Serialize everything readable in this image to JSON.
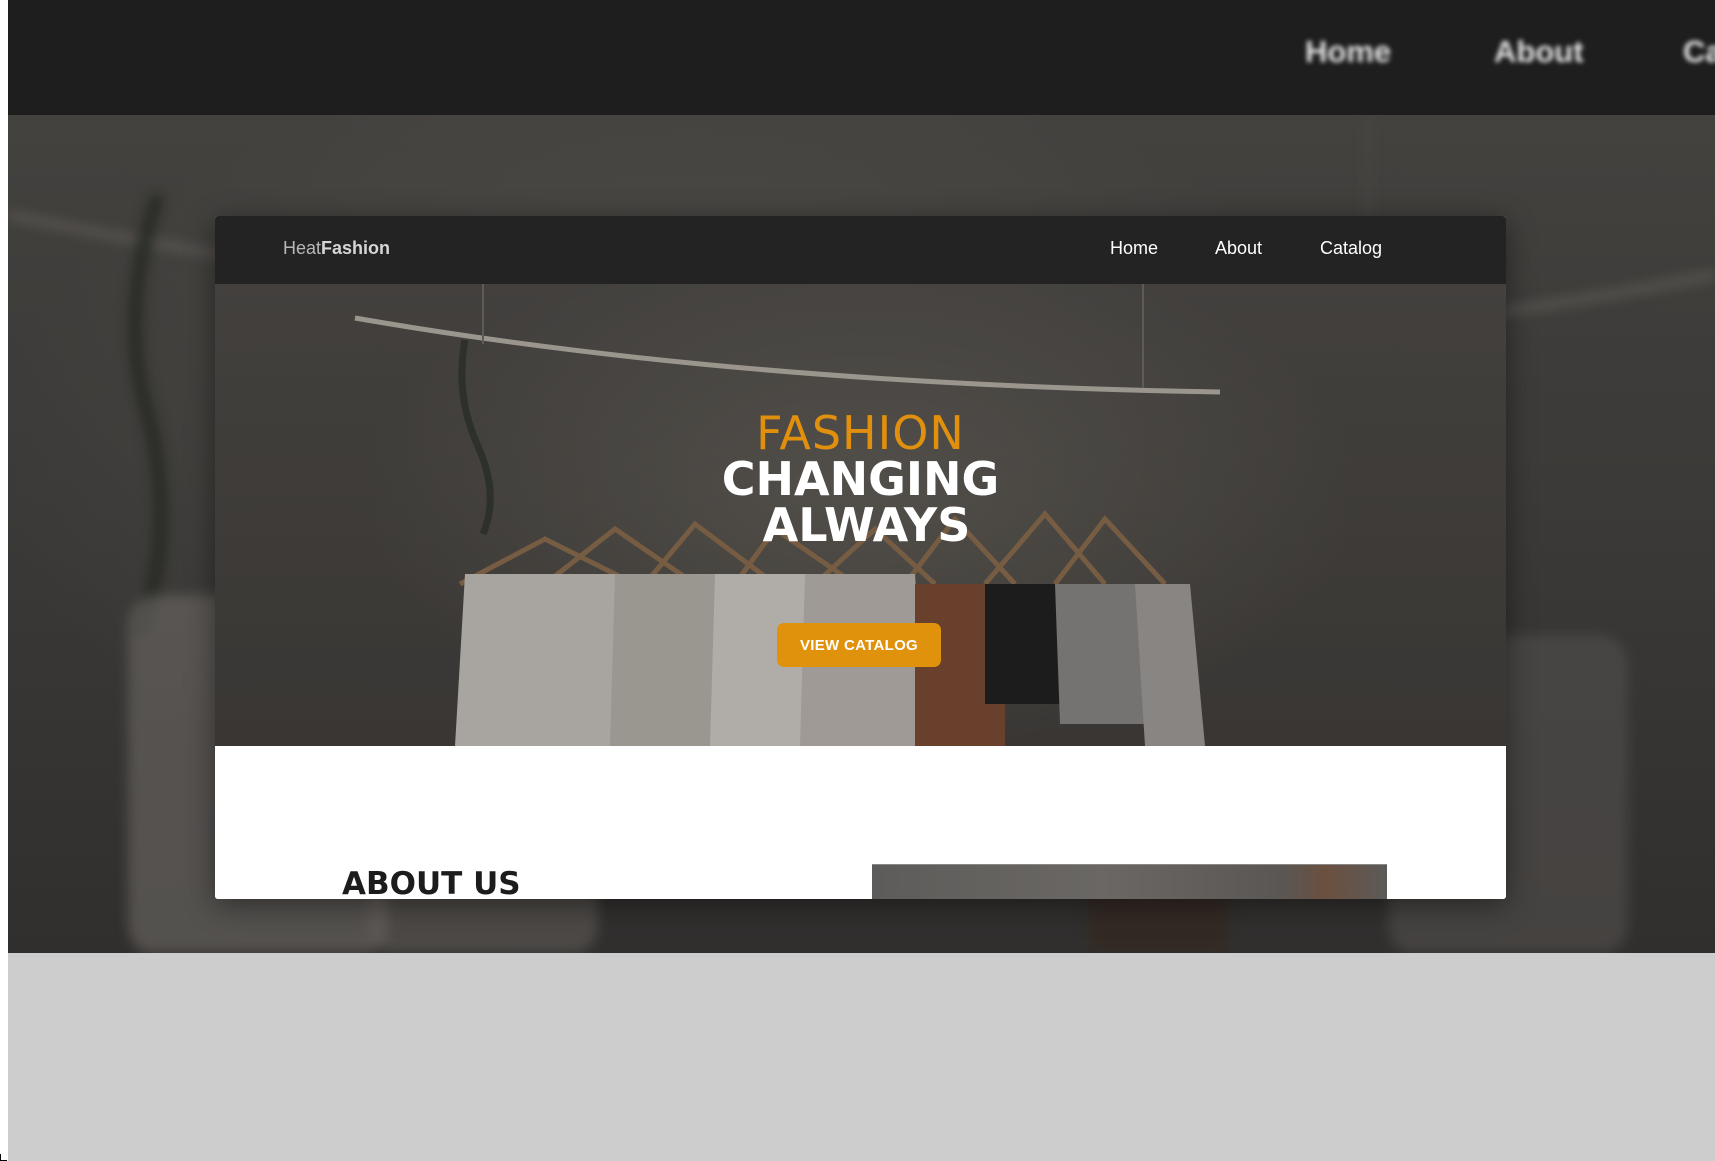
{
  "background": {
    "nav_links": [
      "Home",
      "About",
      "Ca"
    ]
  },
  "window": {
    "logo_light": "Heat",
    "logo_bold": "Fashion",
    "nav": {
      "home": "Home",
      "about": "About",
      "catalog": "Catalog"
    },
    "hero": {
      "line1": "FASHION",
      "line2": "CHANGING",
      "line3": "ALWAYS",
      "button": "VIEW CATALOG"
    },
    "about": {
      "heading": "ABOUT US"
    }
  },
  "colors": {
    "accent": "#e0920c",
    "nav_bg": "#232323",
    "page_nav_bg": "#1e1e1e",
    "lower_bg": "#cdcdcd"
  }
}
